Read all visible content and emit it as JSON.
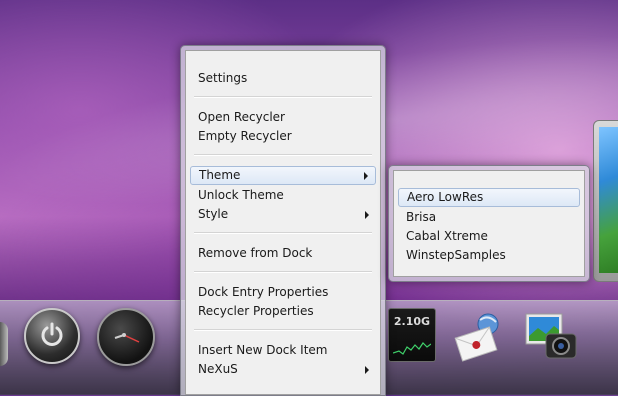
{
  "context_menu": {
    "items": [
      {
        "label": "Settings"
      },
      {
        "label": "Open Recycler"
      },
      {
        "label": "Empty Recycler"
      },
      {
        "label": "Theme"
      },
      {
        "label": "Unlock Theme"
      },
      {
        "label": "Style"
      },
      {
        "label": "Remove from Dock"
      },
      {
        "label": "Dock Entry Properties"
      },
      {
        "label": "Recycler Properties"
      },
      {
        "label": "Insert New Dock Item"
      },
      {
        "label": "NeXuS"
      }
    ],
    "highlighted": "Theme"
  },
  "theme_submenu": {
    "items": [
      {
        "label": "Aero LowRes"
      },
      {
        "label": "Brisa"
      },
      {
        "label": "Cabal Xtreme"
      },
      {
        "label": "WinstepSamples"
      }
    ],
    "highlighted": "Aero LowRes"
  },
  "dock": {
    "net_meter_value": "2.10G",
    "icons": [
      "power-icon",
      "clock-icon",
      "network-meter-icon",
      "mail-icon",
      "photo-camera-icon"
    ]
  },
  "colors": {
    "highlight_border": "#a7bcd9",
    "menu_bg": "#f0f0f0"
  }
}
